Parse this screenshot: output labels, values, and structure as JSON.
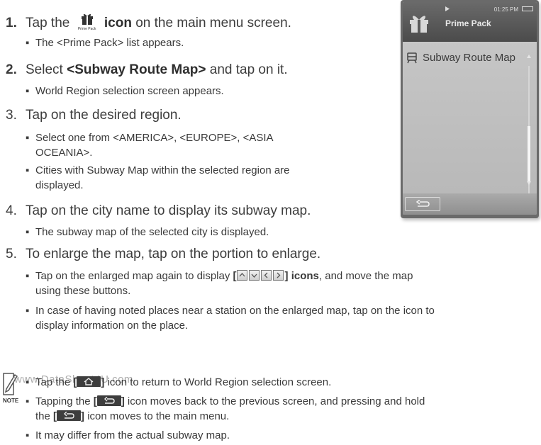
{
  "steps": {
    "s1": {
      "num": "1.",
      "pre": "Tap the",
      "icon_caption": "Prime Pack",
      "post": "icon",
      "rest": "on the main menu screen.",
      "sub1": "The <Prime Pack> list appears."
    },
    "s2": {
      "num": "2.",
      "pre": "Select",
      "bold": "<Subway Route Map>",
      "rest": "and tap on it.",
      "sub1": "World Region selection screen appears."
    },
    "s3": {
      "num": "3.",
      "text": "Tap on the desired region.",
      "sub1_l1": "Select one from <AMERICA>, <EUROPE>, <ASIA",
      "sub1_l2": "OCEANIA>.",
      "sub2_l1": "Cities with Subway Map within the selected region are",
      "sub2_l2": "displayed."
    },
    "s4": {
      "num": "4.",
      "text": "Tap on the city name to display its subway map.",
      "sub1": "The subway map of the selected city is displayed."
    },
    "s5": {
      "num": "5.",
      "text": "To enlarge the map, tap on the portion to enlarge.",
      "sub1_pre": "Tap on the enlarged map again to display",
      "sub1_bold": "icons",
      "sub1_post": ", and move the map",
      "sub1_l2": "using these buttons.",
      "sub2_l1": "In case of having noted places near a station on the enlarged map, tap on the icon to",
      "sub2_l2": "display information on the place."
    }
  },
  "device": {
    "time": "01:25 PM",
    "title": "Prime Pack",
    "list_item": "Subway Route Map"
  },
  "note": {
    "label": "NOTE",
    "watermark": "www.DataSheet4U.com",
    "n1_pre": "Tap the",
    "n1_post": "icon to return to World Region selection screen.",
    "n2_pre": "Tapping the",
    "n2_post": "icon moves back to the previous screen, and pressing and hold",
    "n2_l2_pre": "the",
    "n2_l2_post": "icon moves to the main menu.",
    "n3": "It may differ from the actual subway map."
  },
  "colors": {
    "text": "#3a3a3a",
    "phone_body": "#6a6a6a",
    "screen": "#c2c2c2",
    "button": "#3d3d3d"
  }
}
